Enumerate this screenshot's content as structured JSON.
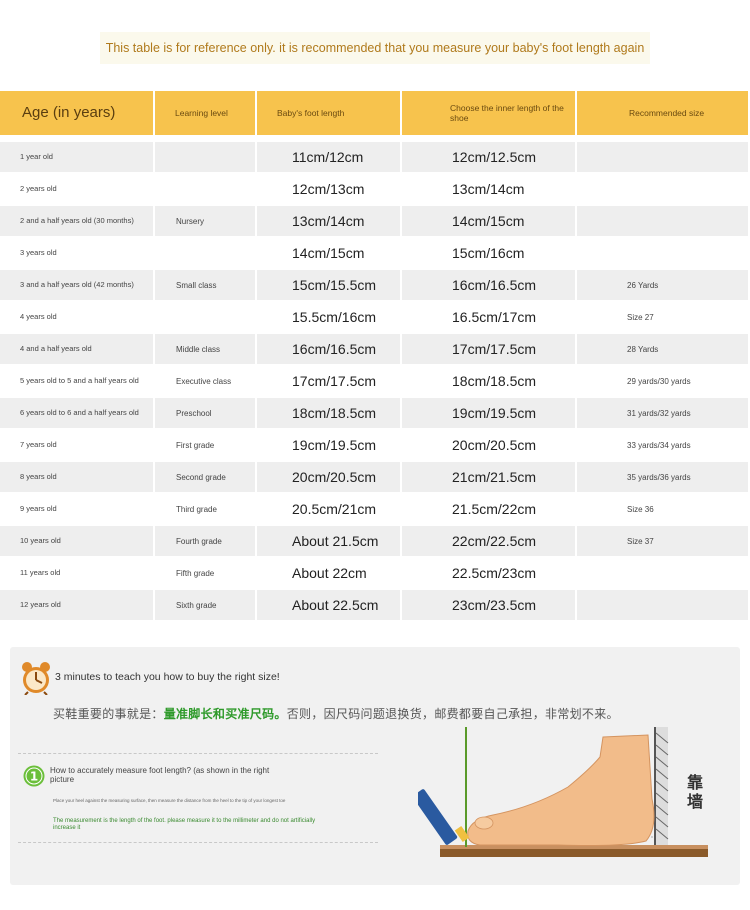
{
  "notice": "This table is for reference only. it is recommended that you measure your baby's foot length again",
  "headers": {
    "age": "Age (in years)",
    "level": "Learning level",
    "foot": "Baby's foot length",
    "shoe": "Choose the inner length of the shoe",
    "size": "Recommended size"
  },
  "rows": [
    {
      "age": "1 year old",
      "level": "",
      "foot": "11cm/12cm",
      "shoe": "12cm/12.5cm",
      "size": ""
    },
    {
      "age": "2 years old",
      "level": "",
      "foot": "12cm/13cm",
      "shoe": "13cm/14cm",
      "size": ""
    },
    {
      "age": "2 and a half years old (30 months)",
      "level": "Nursery",
      "foot": "13cm/14cm",
      "shoe": "14cm/15cm",
      "size": ""
    },
    {
      "age": "3 years old",
      "level": "",
      "foot": "14cm/15cm",
      "shoe": "15cm/16cm",
      "size": ""
    },
    {
      "age": "3 and a half years old (42 months)",
      "level": "Small class",
      "foot": "15cm/15.5cm",
      "shoe": "16cm/16.5cm",
      "size": "26 Yards"
    },
    {
      "age": "4 years old",
      "level": "",
      "foot": "15.5cm/16cm",
      "shoe": "16.5cm/17cm",
      "size": "Size 27"
    },
    {
      "age": "4 and a half years old",
      "level": "Middle class",
      "foot": "16cm/16.5cm",
      "shoe": "17cm/17.5cm",
      "size": "28 Yards"
    },
    {
      "age": "5 years old to 5 and a half years old",
      "level": "Executive class",
      "foot": "17cm/17.5cm",
      "shoe": "18cm/18.5cm",
      "size": "29 yards/30 yards"
    },
    {
      "age": "6 years old to 6 and a half years old",
      "level": "Preschool",
      "foot": "18cm/18.5cm",
      "shoe": "19cm/19.5cm",
      "size": "31 yards/32 yards"
    },
    {
      "age": "7 years old",
      "level": "First grade",
      "foot": "19cm/19.5cm",
      "shoe": "20cm/20.5cm",
      "size": "33 yards/34 yards"
    },
    {
      "age": "8 years old",
      "level": "Second grade",
      "foot": "20cm/20.5cm",
      "shoe": "21cm/21.5cm",
      "size": "35 yards/36 yards"
    },
    {
      "age": "9 years old",
      "level": "Third grade",
      "foot": "20.5cm/21cm",
      "shoe": "21.5cm/22cm",
      "size": "Size 36"
    },
    {
      "age": "10 years old",
      "level": "Fourth grade",
      "foot": "About 21.5cm",
      "shoe": "22cm/22.5cm",
      "size": "Size 37"
    },
    {
      "age": "11 years old",
      "level": "Fifth grade",
      "foot": "About 22cm",
      "shoe": "22.5cm/23cm",
      "size": ""
    },
    {
      "age": "12 years old",
      "level": "Sixth grade",
      "foot": "About 22.5cm",
      "shoe": "23cm/23.5cm",
      "size": ""
    }
  ],
  "guide": {
    "title": "3 minutes to teach you how to buy the right size!",
    "cn_prefix": "买鞋重要的事就是：",
    "cn_highlight": "量准脚长和买准尺码。",
    "cn_suffix": "否则，因尺码问题退换货，邮费都要自己承担，非常划不来。",
    "step_number": "1",
    "step_title": "How to accurately measure foot length? (as shown in the right picture",
    "step_detail": "Place your heel against the measuring surface, then measure the distance from the heel to the tip of your longest toe",
    "step_note": "The measurement is the length of the foot. please measure it to the millimeter and do not artificially increase it",
    "wall_label": "靠墙"
  },
  "colors": {
    "header": "#f7c34d",
    "row_shade": "#eeeeee",
    "notice_text": "#b07a1c",
    "highlight_green": "#2e9a2a",
    "badge_green": "#6bbf3a"
  },
  "icons": [
    "alarm-clock-icon",
    "step-one-badge-icon",
    "foot-measure-illustration"
  ]
}
